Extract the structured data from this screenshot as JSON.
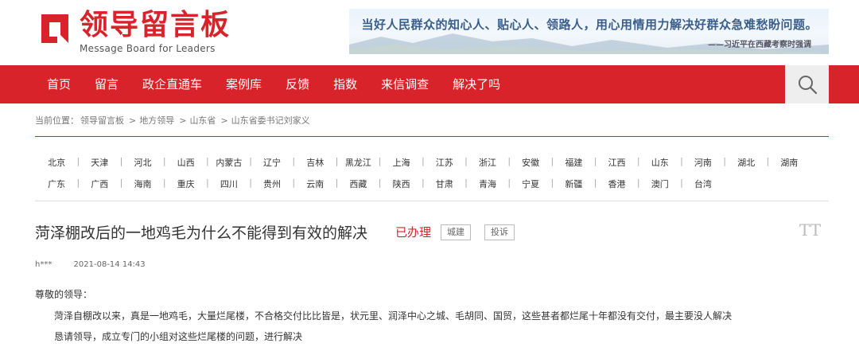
{
  "logo": {
    "title_cn": "领导留言板",
    "title_en": "Message Board for Leaders"
  },
  "banner": {
    "main": "当好人民群众的知心人、贴心人、领路人，用心用情用力解决好群众急难愁盼问题。",
    "sub": "——习近平在西藏考察时强调"
  },
  "nav": {
    "items": [
      "首页",
      "留言",
      "政企直通车",
      "案例库",
      "反馈",
      "指数",
      "来信调查",
      "解决了吗"
    ]
  },
  "breadcrumb": {
    "label": "当前位置：",
    "items": [
      "领导留言板",
      "地方领导",
      "山东省",
      "山东省委书记刘家义"
    ],
    "separator": ">"
  },
  "provinces": {
    "row1": [
      "北京",
      "天津",
      "河北",
      "山西",
      "内蒙古",
      "辽宁",
      "吉林",
      "黑龙江",
      "上海",
      "江苏",
      "浙江",
      "安徽",
      "福建",
      "江西",
      "山东",
      "河南",
      "湖北",
      "湖南"
    ],
    "row2": [
      "广东",
      "广西",
      "海南",
      "重庆",
      "四川",
      "贵州",
      "云南",
      "西藏",
      "陕西",
      "甘肃",
      "青海",
      "宁夏",
      "新疆",
      "香港",
      "澳门",
      "台湾"
    ]
  },
  "message": {
    "title": "菏泽棚改后的一地鸡毛为什么不能得到有效的解决",
    "status": "已办理",
    "tags": [
      "城建",
      "投诉"
    ],
    "font_toggle": "TT",
    "author": "h***",
    "date": "2021-08-14 14:43",
    "greeting": "尊敬的领导：",
    "line1": "菏泽自棚改以来，真是一地鸡毛，大量烂尾楼，不合格交付比比皆是，状元里、润泽中心之城、毛胡同、国贸，这些甚者都烂尾十年都没有交付，最主要没人解决",
    "line2": "恳请领导，成立专门的小组对这些烂尾楼的问题，进行解决"
  },
  "colors": {
    "brand_red": "#d8232a",
    "nav_text": "#ffffff"
  }
}
